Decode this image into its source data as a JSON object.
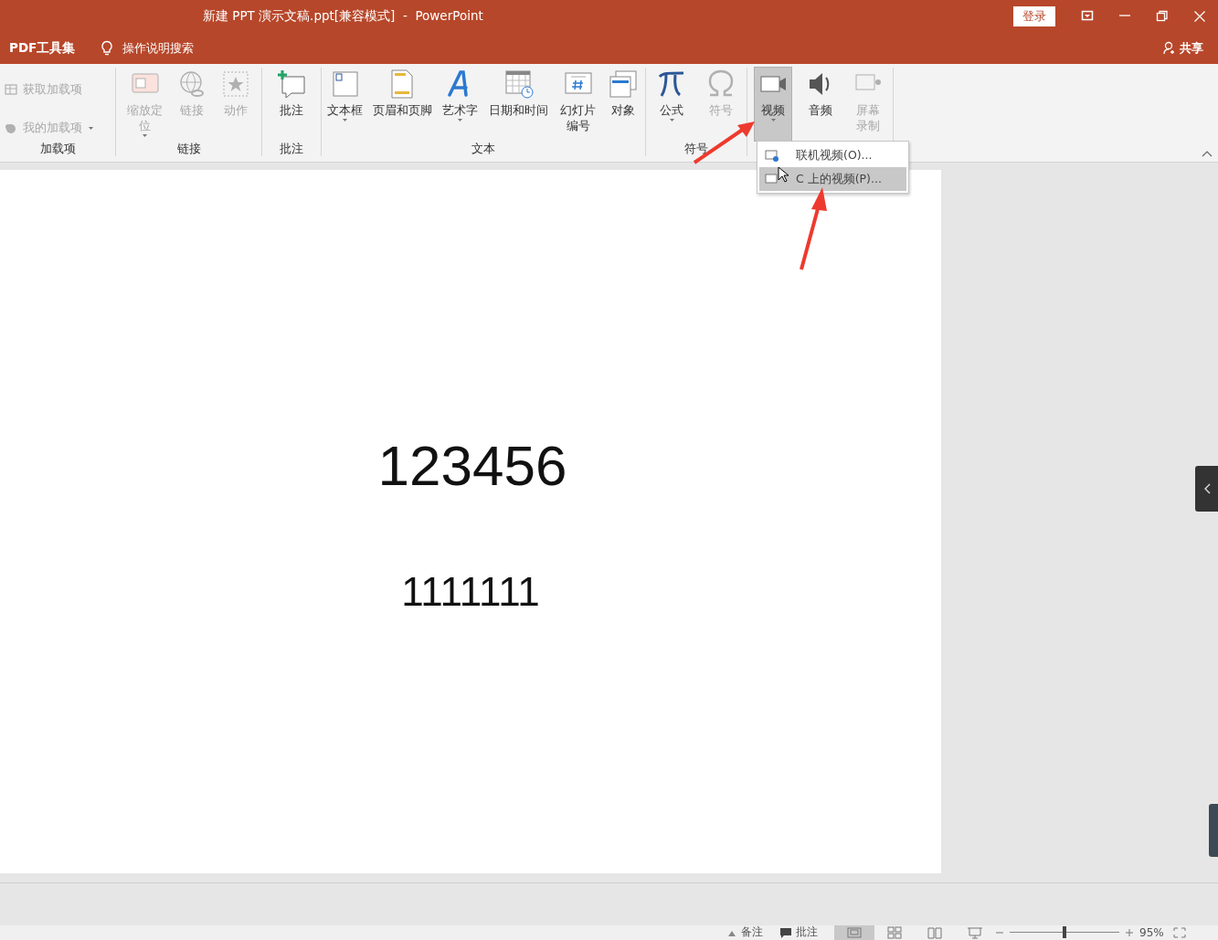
{
  "window": {
    "title": "新建 PPT 演示文稿.ppt[兼容模式]  -  PowerPoint",
    "login_button": "登录"
  },
  "menu_bar": {
    "tabs": [
      {
        "label": "PDF工具集"
      }
    ],
    "search_placeholder": "操作说明搜索",
    "share": "共享"
  },
  "ribbon": {
    "groups": [
      {
        "label": "加载项",
        "items": [
          {
            "label": "获取加载项",
            "kind": "small",
            "disabled": true,
            "dropdown": false,
            "pressed": false
          },
          {
            "label": "我的加载项",
            "kind": "small",
            "disabled": true,
            "dropdown": true,
            "pressed": false
          }
        ]
      },
      {
        "label": "链接",
        "items": [
          {
            "label": "缩放定位",
            "kind": "large",
            "disabled": true,
            "dropdown": true,
            "pressed": false
          },
          {
            "label": "链接",
            "kind": "large",
            "disabled": true,
            "dropdown": false,
            "pressed": false
          },
          {
            "label": "动作",
            "kind": "large",
            "disabled": true,
            "dropdown": false,
            "pressed": false
          }
        ]
      },
      {
        "label": "批注",
        "items": [
          {
            "label": "批注",
            "kind": "large",
            "disabled": false,
            "dropdown": false,
            "pressed": false
          }
        ]
      },
      {
        "label": "文本",
        "items": [
          {
            "label": "文本框",
            "kind": "large",
            "disabled": false,
            "dropdown": true,
            "pressed": false
          },
          {
            "label": "页眉和页脚",
            "kind": "large",
            "disabled": false,
            "dropdown": false,
            "pressed": false
          },
          {
            "label": "艺术字",
            "kind": "large",
            "disabled": false,
            "dropdown": true,
            "pressed": false
          },
          {
            "label": "日期和时间",
            "kind": "large",
            "disabled": false,
            "dropdown": false,
            "pressed": false
          },
          {
            "label": "幻灯片编号",
            "kind": "large",
            "disabled": false,
            "dropdown": false,
            "pressed": false
          },
          {
            "label": "对象",
            "kind": "large",
            "disabled": false,
            "dropdown": false,
            "pressed": false
          }
        ]
      },
      {
        "label": "符号",
        "items": [
          {
            "label": "公式",
            "kind": "large",
            "disabled": false,
            "dropdown": true,
            "pressed": false
          },
          {
            "label": "符号",
            "kind": "large",
            "disabled": true,
            "dropdown": false,
            "pressed": false
          }
        ]
      },
      {
        "items": [
          {
            "label": "视频",
            "kind": "large",
            "disabled": false,
            "dropdown": true,
            "pressed": true
          },
          {
            "label": "音频",
            "kind": "large",
            "disabled": false,
            "dropdown": false,
            "pressed": false
          },
          {
            "label": "屏幕录制",
            "kind": "large",
            "disabled": true,
            "dropdown": false,
            "pressed": false
          }
        ]
      }
    ]
  },
  "dropdown_menu": {
    "items": [
      {
        "label": "联机视频(O)...",
        "selected": false
      },
      {
        "label": "C 上的视频(P)...",
        "selected": true
      }
    ]
  },
  "slide": {
    "texts": [
      "123456",
      "1111111"
    ]
  },
  "status_bar": {
    "notes": "备注",
    "comments": "批注",
    "views": [
      {
        "selected": true
      },
      {
        "selected": false
      },
      {
        "selected": false
      },
      {
        "selected": false
      }
    ],
    "zoom": {
      "level": 0.5,
      "reading": "95%"
    }
  }
}
